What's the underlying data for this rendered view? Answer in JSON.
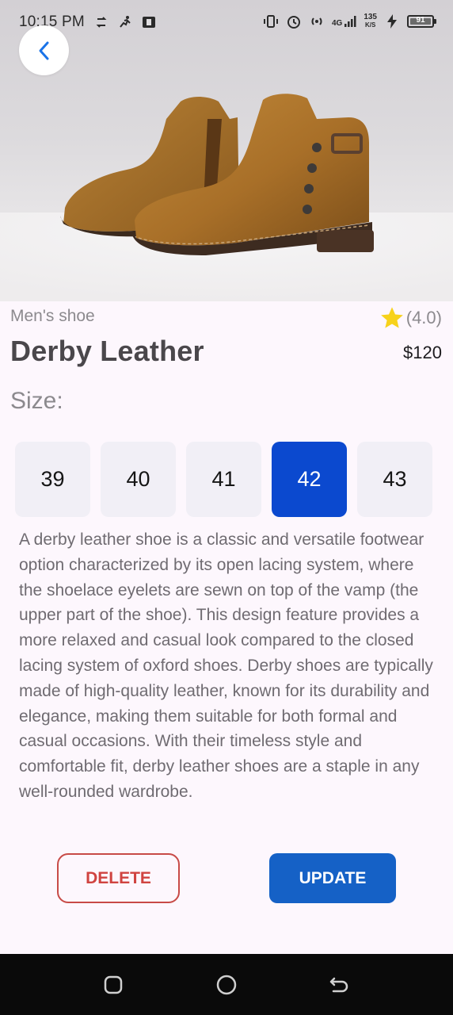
{
  "status_bar": {
    "time": "10:15 PM",
    "network_type": "4G",
    "net_speed_value": "135",
    "net_speed_unit": "K/S",
    "battery": "91"
  },
  "icons": {
    "back": "chevron-left-icon",
    "star": "star-icon"
  },
  "product": {
    "category": "Men's shoe",
    "rating": "(4.0)",
    "name": "Derby Leather",
    "price": "$120",
    "size_label": "Size:",
    "sizes": [
      "39",
      "40",
      "41",
      "42",
      "43"
    ],
    "selected_size": "42",
    "description": "A derby leather shoe is a classic and versatile footwear option characterized by its open lacing system, where the shoelace eyelets are sewn on top of the vamp (the upper part of the shoe). This design feature provides a more relaxed and casual look compared to the closed lacing system of oxford shoes. Derby shoes are typically made of high-quality leather, known for its durability and elegance, making them suitable for both formal and casual occasions. With their timeless style and comfortable fit, derby leather shoes are a staple in any well-rounded wardrobe."
  },
  "actions": {
    "delete_label": "DELETE",
    "update_label": "UPDATE"
  },
  "colors": {
    "selected_size": "#0b49cf",
    "update_button": "#1561c6",
    "delete_border": "#c84b47",
    "star": "#f7d21b"
  }
}
